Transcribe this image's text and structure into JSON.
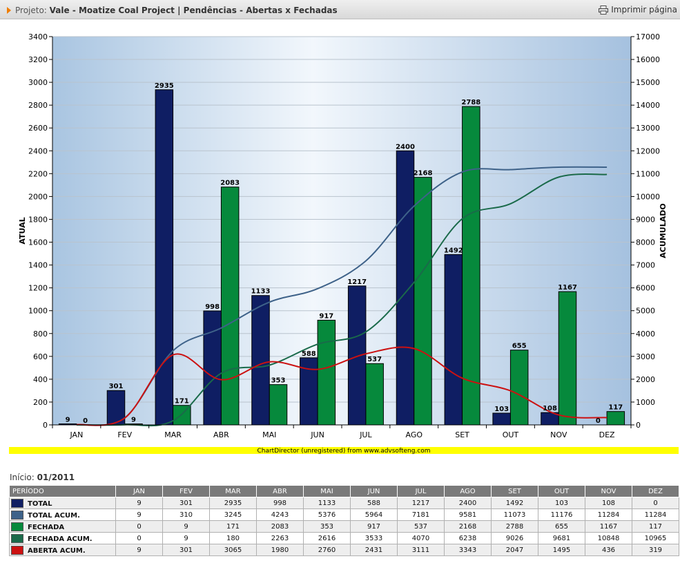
{
  "header": {
    "project_label": "Projeto:",
    "project_title": "Vale - Moatize Coal Project | Pendências - Abertas x Fechadas",
    "print_label": "Imprimir página"
  },
  "colors": {
    "total": "#0f1e63",
    "fechada": "#06893c",
    "total_acum": "#3e6289",
    "fechada_acum": "#1a6a4a",
    "aberta_acum": "#cc1111",
    "watermark_bar": "#ffff00"
  },
  "chart_data": {
    "type": "bar",
    "categories": [
      "JAN",
      "FEV",
      "MAR",
      "ABR",
      "MAI",
      "JUN",
      "JUL",
      "AGO",
      "SET",
      "OUT",
      "NOV",
      "DEZ"
    ],
    "ylabel": "ATUAL",
    "y2label": "ACUMULADO",
    "ylim": [
      0,
      3400
    ],
    "y2lim": [
      0,
      17000
    ],
    "yticks": [
      0,
      200,
      400,
      600,
      800,
      1000,
      1200,
      1400,
      1600,
      1800,
      2000,
      2200,
      2400,
      2600,
      2800,
      3000,
      3200,
      3400
    ],
    "y2ticks": [
      0,
      1000,
      2000,
      3000,
      4000,
      5000,
      6000,
      7000,
      8000,
      9000,
      10000,
      11000,
      12000,
      13000,
      14000,
      15000,
      16000,
      17000
    ],
    "grid": true,
    "watermark": "ChartDirector (unregistered) from www.advsofteng.com",
    "series": [
      {
        "name": "TOTAL",
        "kind": "bar",
        "axis": "left",
        "color": "#0f1e63",
        "values": [
          9,
          301,
          2935,
          998,
          1133,
          588,
          1217,
          2400,
          1492,
          103,
          108,
          0
        ]
      },
      {
        "name": "FECHADA",
        "kind": "bar",
        "axis": "left",
        "color": "#06893c",
        "values": [
          0,
          9,
          171,
          2083,
          353,
          917,
          537,
          2168,
          2788,
          655,
          1167,
          117
        ]
      },
      {
        "name": "TOTAL ACUM.",
        "kind": "line",
        "axis": "right",
        "color": "#3e6289",
        "values": [
          9,
          310,
          3245,
          4243,
          5376,
          5964,
          7181,
          9581,
          11073,
          11176,
          11284,
          11284
        ]
      },
      {
        "name": "FECHADA ACUM.",
        "kind": "line",
        "axis": "right",
        "color": "#1a6a4a",
        "values": [
          0,
          9,
          180,
          2263,
          2616,
          3533,
          4070,
          6238,
          9026,
          9681,
          10848,
          10965
        ]
      },
      {
        "name": "ABERTA ACUM.",
        "kind": "line",
        "axis": "right",
        "color": "#cc1111",
        "values": [
          9,
          301,
          3065,
          1980,
          2760,
          2431,
          3111,
          3343,
          2047,
          1495,
          436,
          319
        ]
      }
    ]
  },
  "summary": {
    "inicio_label": "Início:",
    "inicio_value": "01/2011",
    "period_header": "PERÍODO"
  }
}
